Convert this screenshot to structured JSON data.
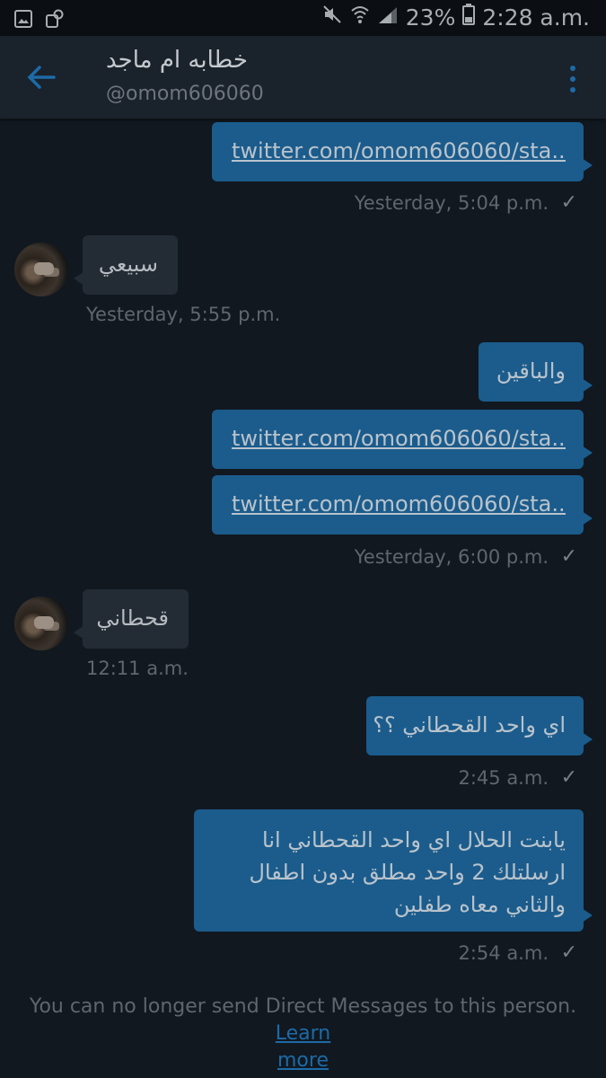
{
  "status_bar": {
    "battery": "23%",
    "time": "2:28 a.m."
  },
  "header": {
    "name": "خطابه ام ماجد",
    "handle": "@omom606060"
  },
  "messages": [
    {
      "type": "out",
      "text": "twitter.com/omom606060/sta..."
    },
    {
      "type": "time_out",
      "text": "Yesterday, 5:04 p.m."
    },
    {
      "type": "in",
      "text": "سبيعي"
    },
    {
      "type": "time_in",
      "text": "Yesterday, 5:55 p.m."
    },
    {
      "type": "out",
      "text": "والباقين"
    },
    {
      "type": "out",
      "text": "twitter.com/omom606060/sta..."
    },
    {
      "type": "out",
      "text": "twitter.com/omom606060/sta..."
    },
    {
      "type": "time_out",
      "text": "Yesterday, 6:00 p.m."
    },
    {
      "type": "in",
      "text": "قحطاني"
    },
    {
      "type": "time_in",
      "text": "12:11 a.m."
    },
    {
      "type": "out",
      "text": "اي واحد القحطاني ؟؟"
    },
    {
      "type": "time_out",
      "text": "2:45 a.m."
    },
    {
      "type": "out",
      "lines": [
        "يابنت الحلال اي واحد القحطاني انا",
        "ارسلتلك 2 واحد مطلق بدون اطفال",
        "والثاني معاه طفلين"
      ]
    },
    {
      "type": "time_out",
      "text": "2:54 a.m."
    }
  ],
  "footer": {
    "notice": "You can no longer send Direct Messages to this person.",
    "learn": "Learn",
    "more": "more"
  },
  "colors": {
    "background": "#111820",
    "sent_bubble": "#1b5c8c",
    "received_bubble": "#232c35",
    "accent": "#1d6aa6"
  }
}
